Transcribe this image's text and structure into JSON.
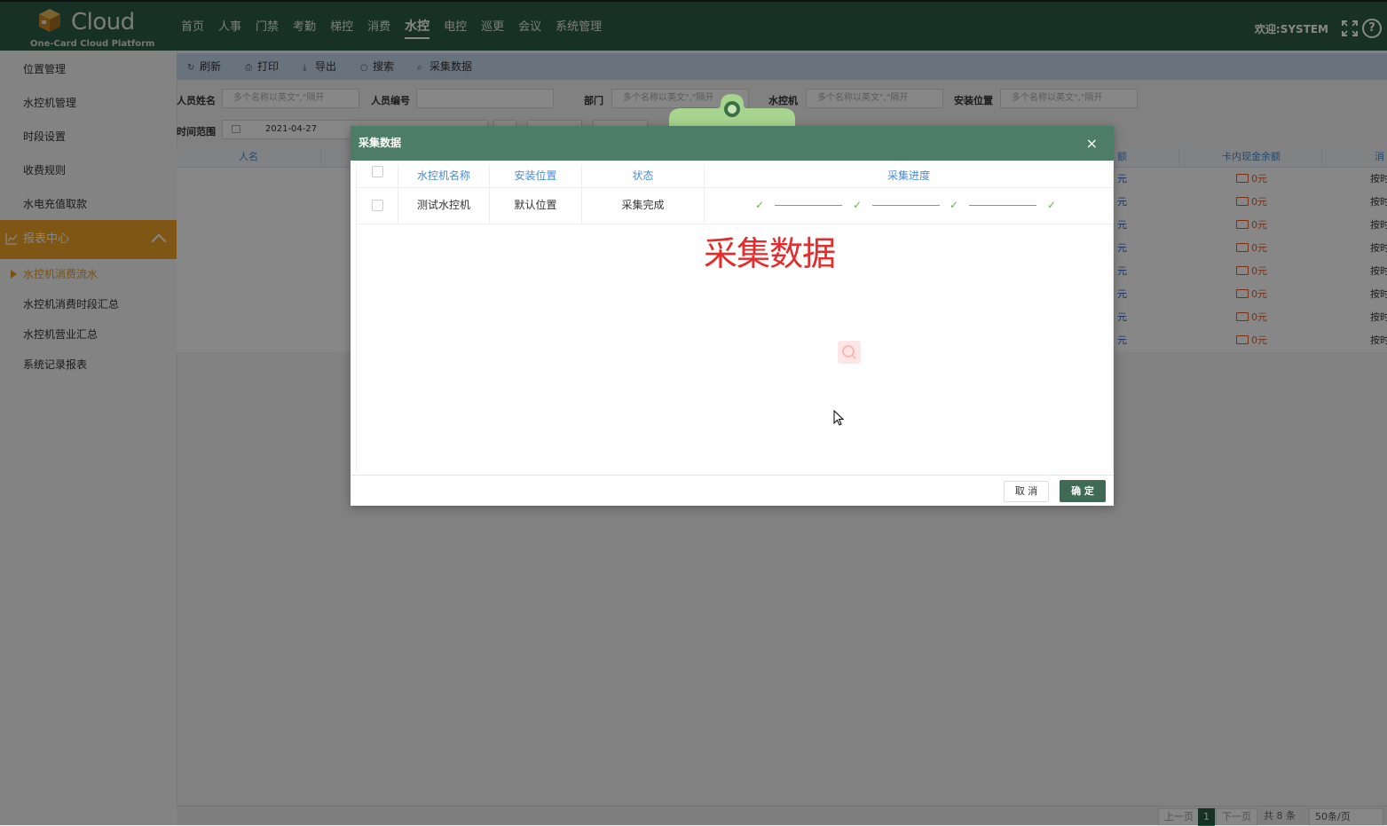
{
  "app": {
    "logo_word": "Cloud",
    "logo_sub": "One-Card Cloud Platform",
    "welcome": "欢迎:SYSTEM",
    "help_glyph": "?"
  },
  "nav": [
    "首页",
    "人事",
    "门禁",
    "考勤",
    "梯控",
    "消费",
    "水控",
    "电控",
    "巡更",
    "会议",
    "系统管理"
  ],
  "nav_active": "水控",
  "sidebar": {
    "items": [
      "位置管理",
      "水控机管理",
      "时段设置",
      "收费规则",
      "水电充值取款"
    ],
    "section": "报表中心",
    "subitems": [
      "水控机消费流水",
      "水控机消费时段汇总",
      "水控机营业汇总",
      "系统记录报表"
    ],
    "active_sub": "水控机消费流水"
  },
  "toolbar": {
    "refresh": "刷新",
    "print": "打印",
    "export": "导出",
    "search": "搜索",
    "collect": "采集数据"
  },
  "filters": {
    "name_label": "人员姓名",
    "name_placeholder": "多个名称以英文\",\"隔开",
    "id_label": "人员编号",
    "dept_label": "部门",
    "dept_placeholder": "多个名称以英文\",\"隔开",
    "device_label": "水控机",
    "device_placeholder": "多个名称以英文\",\"隔开",
    "location_label": "安装位置",
    "location_placeholder": "多个名称以英文\",\"隔开",
    "time_label": "时间范围",
    "date_from": "2021-04-27"
  },
  "grid": {
    "headers": {
      "name": "人名",
      "amount": "额",
      "cash_balance": "卡内现金余额",
      "mode": "消"
    },
    "rows": [
      {
        "amount": "元",
        "cash": "0元",
        "mode": "按时"
      },
      {
        "amount": "元",
        "cash": "0元",
        "mode": "按时"
      },
      {
        "amount": "元",
        "cash": "0元",
        "mode": "按时"
      },
      {
        "amount": "元",
        "cash": "0元",
        "mode": "按时"
      },
      {
        "amount": "元",
        "cash": "0元",
        "mode": "按时"
      },
      {
        "amount": "元",
        "cash": "0元",
        "mode": "按时"
      },
      {
        "amount": "元",
        "cash": "0元",
        "mode": "按时"
      },
      {
        "amount": "元",
        "cash": "0元",
        "mode": "按时"
      }
    ]
  },
  "pager": {
    "prev": "上一页",
    "current": "1",
    "next": "下一页",
    "total": "共 8 条",
    "page_size": "50条/页"
  },
  "modal": {
    "title": "采集数据",
    "close": "×",
    "headers": [
      "水控机名称",
      "安装位置",
      "状态",
      "采集进度"
    ],
    "rows": [
      {
        "name": "测试水控机",
        "location": "默认位置",
        "status": "采集完成"
      }
    ],
    "progress_steps": 4,
    "cancel": "取 消",
    "ok": "确 定"
  },
  "caption": "采集数据",
  "colors": {
    "topbar": "#2f5d4b",
    "accent": "#f0a326",
    "modal_header": "#4e7d67",
    "success": "#67b346"
  }
}
